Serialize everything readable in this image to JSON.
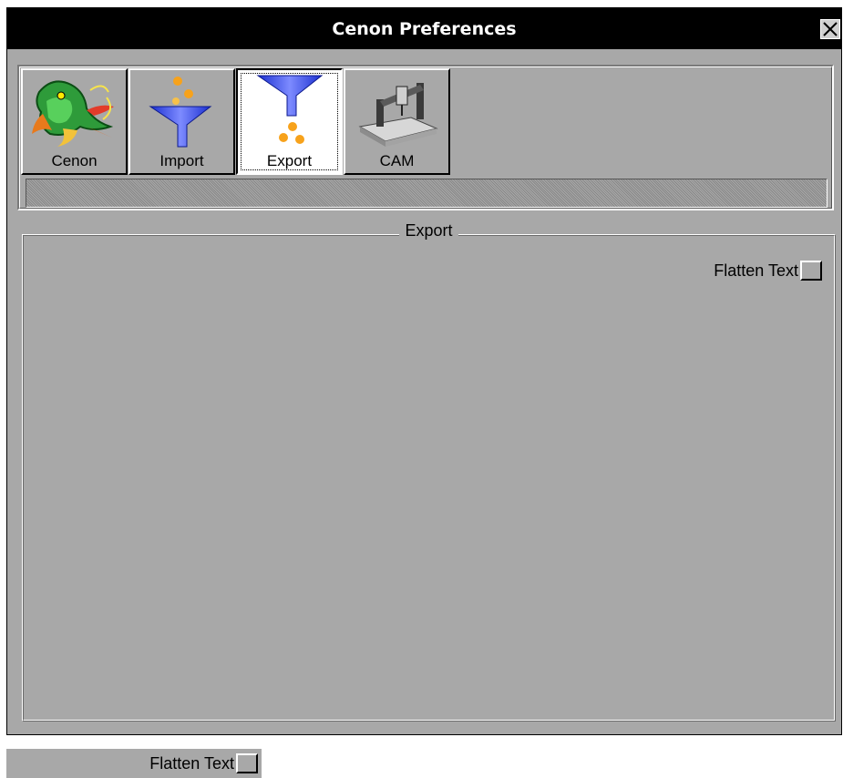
{
  "window": {
    "title": "Cenon Preferences",
    "close_icon": "close-icon"
  },
  "toolbar": {
    "items": [
      {
        "label": "Cenon",
        "icon": "dragon-icon",
        "active": false
      },
      {
        "label": "Import",
        "icon": "funnel-import-icon",
        "active": false
      },
      {
        "label": "Export",
        "icon": "funnel-export-icon",
        "active": true
      },
      {
        "label": "CAM",
        "icon": "cnc-machine-icon",
        "active": false
      }
    ]
  },
  "panel": {
    "title": "Export",
    "flatten_text_label": "Flatten Text",
    "flatten_text_checked": false
  },
  "ghost_switch": {
    "label": "Flatten Text",
    "checked": false
  },
  "colors": {
    "window_bg": "#a8a8a8",
    "titlebar_bg": "#000000",
    "titlebar_fg": "#ffffff"
  }
}
